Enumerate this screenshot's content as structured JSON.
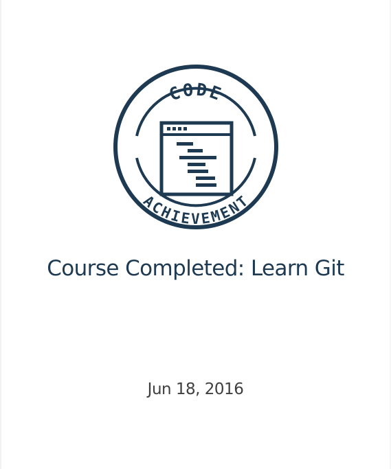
{
  "badge": {
    "top_text": "CODE",
    "bottom_text": "ACHIEVEMENT",
    "color": "#1d3a52",
    "icon": "code-window-icon"
  },
  "achievement": {
    "title": "Course Completed: Learn Git",
    "date": "Jun 18, 2016"
  },
  "colors": {
    "primary": "#1d3a52",
    "date_text": "#3f3f3f",
    "background": "#ffffff"
  }
}
